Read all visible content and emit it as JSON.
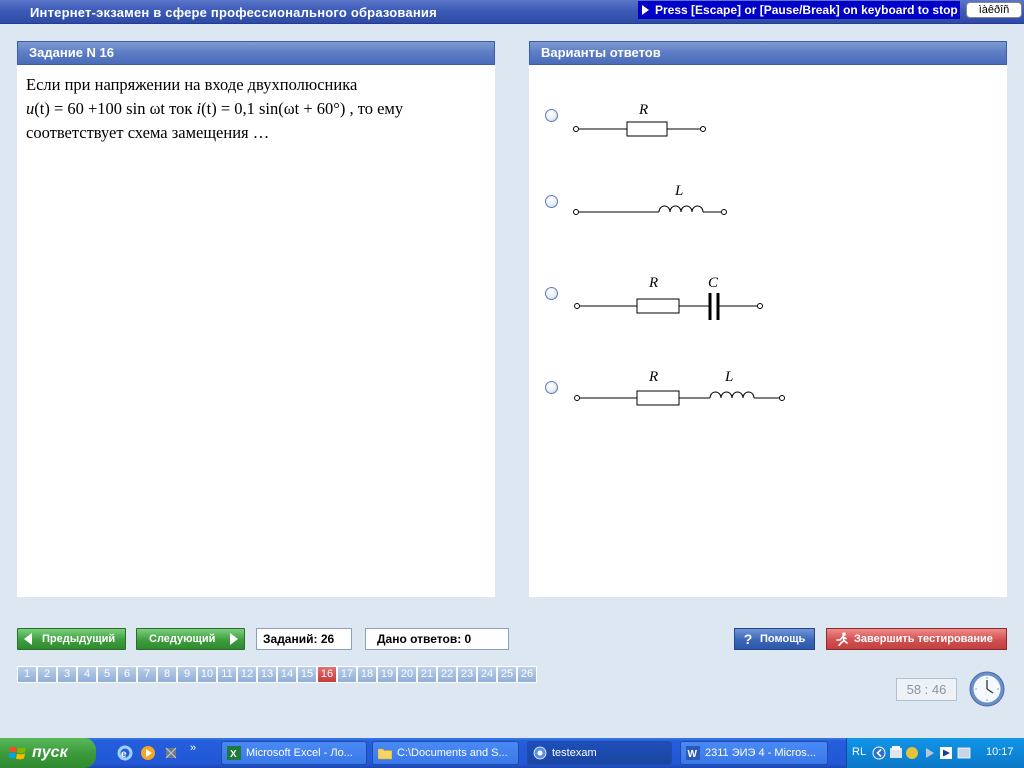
{
  "app": {
    "title": "Интернет-экзамен в сфере профессионального образования",
    "escape_hint": "Press [Escape] or [Pause/Break] on keyboard to stop",
    "lang_box": "ìàêðîñ"
  },
  "question": {
    "header": "Задание N 16",
    "line1": "Если при напряжении на входе двухполюсника",
    "line2_u": "u",
    "line2_expr_u": "(t) = 60 +100 sin ωt",
    "line2_mid": "ток",
    "line2_i": "i",
    "line2_expr_i": "(t) = 0,1 sin(ωt + 60°)",
    "line2_tail": ", то ему",
    "line3": "соответствует схема замещения …"
  },
  "answers": {
    "header": "Варианты ответов",
    "options": [
      {
        "labels": [
          "R"
        ]
      },
      {
        "labels": [
          "L"
        ]
      },
      {
        "labels": [
          "R",
          "C"
        ]
      },
      {
        "labels": [
          "R",
          "L"
        ]
      }
    ]
  },
  "nav": {
    "prev_label": "Предыдущий",
    "next_label": "Следующий",
    "tasks_count": "Заданий: 26",
    "answers_count": "Дано ответов: 0",
    "help_label": "Помощь",
    "finish_label": "Завершить тестирование",
    "question_numbers": [
      "1",
      "2",
      "3",
      "4",
      "5",
      "6",
      "7",
      "8",
      "9",
      "10",
      "11",
      "12",
      "13",
      "14",
      "15",
      "16",
      "17",
      "18",
      "19",
      "20",
      "21",
      "22",
      "23",
      "24",
      "25",
      "26"
    ],
    "active_question": "16",
    "timer": "58 : 46"
  },
  "taskbar": {
    "start_label": "пуск",
    "tasks": [
      {
        "label": "Microsoft Excel - Ло...",
        "icon": "excel-icon"
      },
      {
        "label": "C:\\Documents and S...",
        "icon": "folder-icon"
      },
      {
        "label": "testexam",
        "icon": "testexam-icon"
      },
      {
        "label": "2311 ЭИЭ 4 - Micros...",
        "icon": "word-icon"
      }
    ],
    "tray_lang": "RL",
    "clock": "10:17"
  }
}
